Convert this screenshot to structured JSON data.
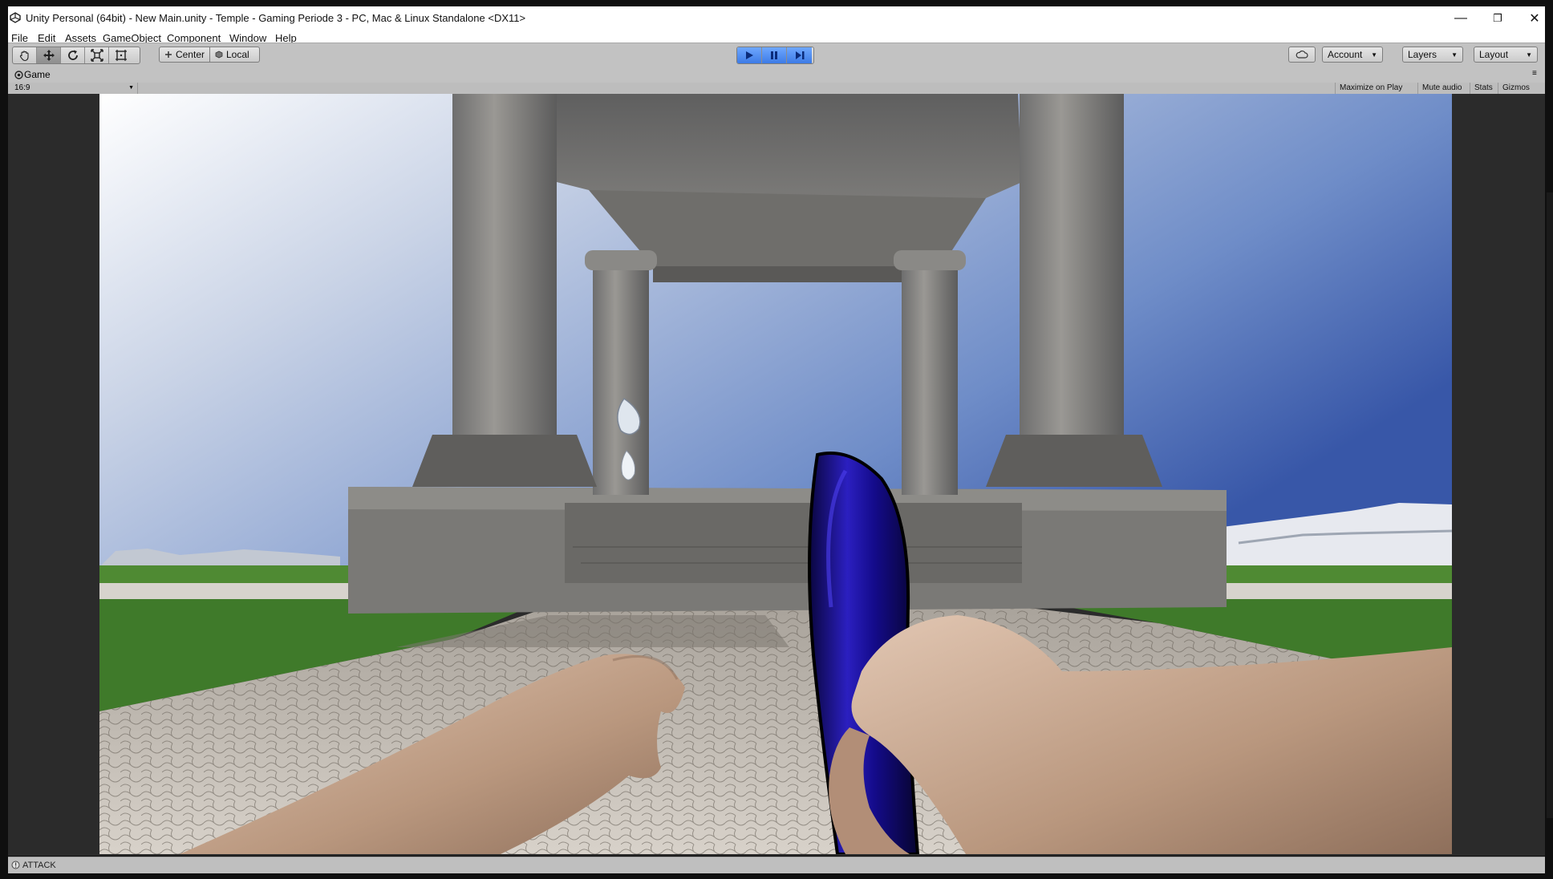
{
  "window": {
    "title": "Unity Personal (64bit) - New Main.unity - Temple - Gaming Periode 3 - PC, Mac & Linux Standalone <DX11>",
    "minimize_glyph": "—",
    "restore_glyph": "❐",
    "close_glyph": "✕"
  },
  "menu": {
    "items": [
      "File",
      "Edit",
      "Assets",
      "GameObject",
      "Component",
      "Window",
      "Help"
    ]
  },
  "toolbar": {
    "tools": [
      "hand-tool",
      "move-tool",
      "rotate-tool",
      "scale-tool",
      "rect-tool"
    ],
    "active_tool": "move-tool",
    "pivot_label": "Center",
    "space_label": "Local",
    "play_state": "playing",
    "account_label": "Account",
    "layers_label": "Layers",
    "layout_label": "Layout"
  },
  "game_view": {
    "tab_label": "Game",
    "aspect_label": "16:9",
    "maximize_label": "Maximize on Play",
    "mute_label": "Mute audio",
    "stats_label": "Stats",
    "gizmos_label": "Gizmos"
  },
  "status": {
    "message": "ATTACK"
  },
  "colors": {
    "accent": "#3d7be6",
    "editor_gray": "#c2c2c2",
    "sky_top": "#3f63b0",
    "grass": "#4f8a33",
    "bottle": "#1a0f8a",
    "skin": "#c9a88e"
  }
}
